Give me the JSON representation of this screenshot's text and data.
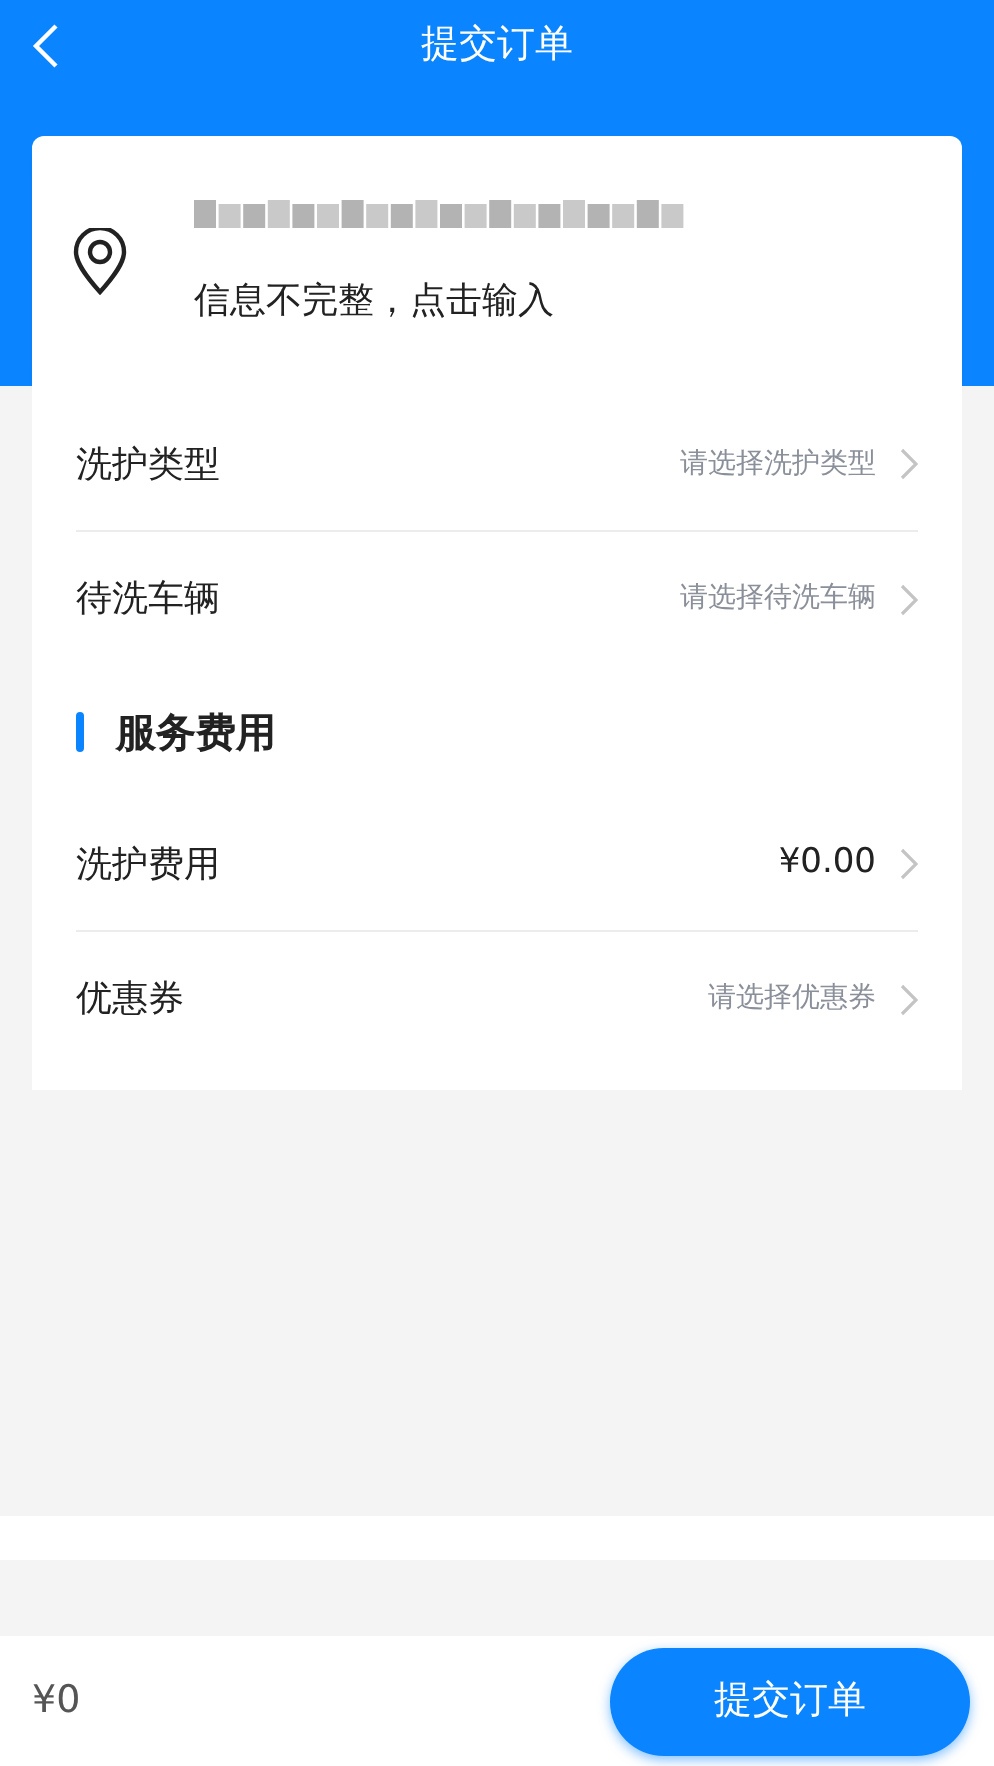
{
  "header": {
    "title": "提交订单"
  },
  "address": {
    "hint": "信息不完整，点击输入"
  },
  "order_rows": [
    {
      "label": "洗护类型",
      "kind": "select",
      "value": "请选择洗护类型"
    },
    {
      "label": "待洗车辆",
      "kind": "select",
      "value": "请选择待洗车辆"
    }
  ],
  "section": {
    "title": "服务费用"
  },
  "fee_rows": [
    {
      "label": "洗护费用",
      "kind": "value",
      "value": "¥0.00"
    },
    {
      "label": "优惠券",
      "kind": "select",
      "value": "请选择优惠券"
    }
  ],
  "footer": {
    "total": "¥0",
    "submit": "提交订单"
  }
}
